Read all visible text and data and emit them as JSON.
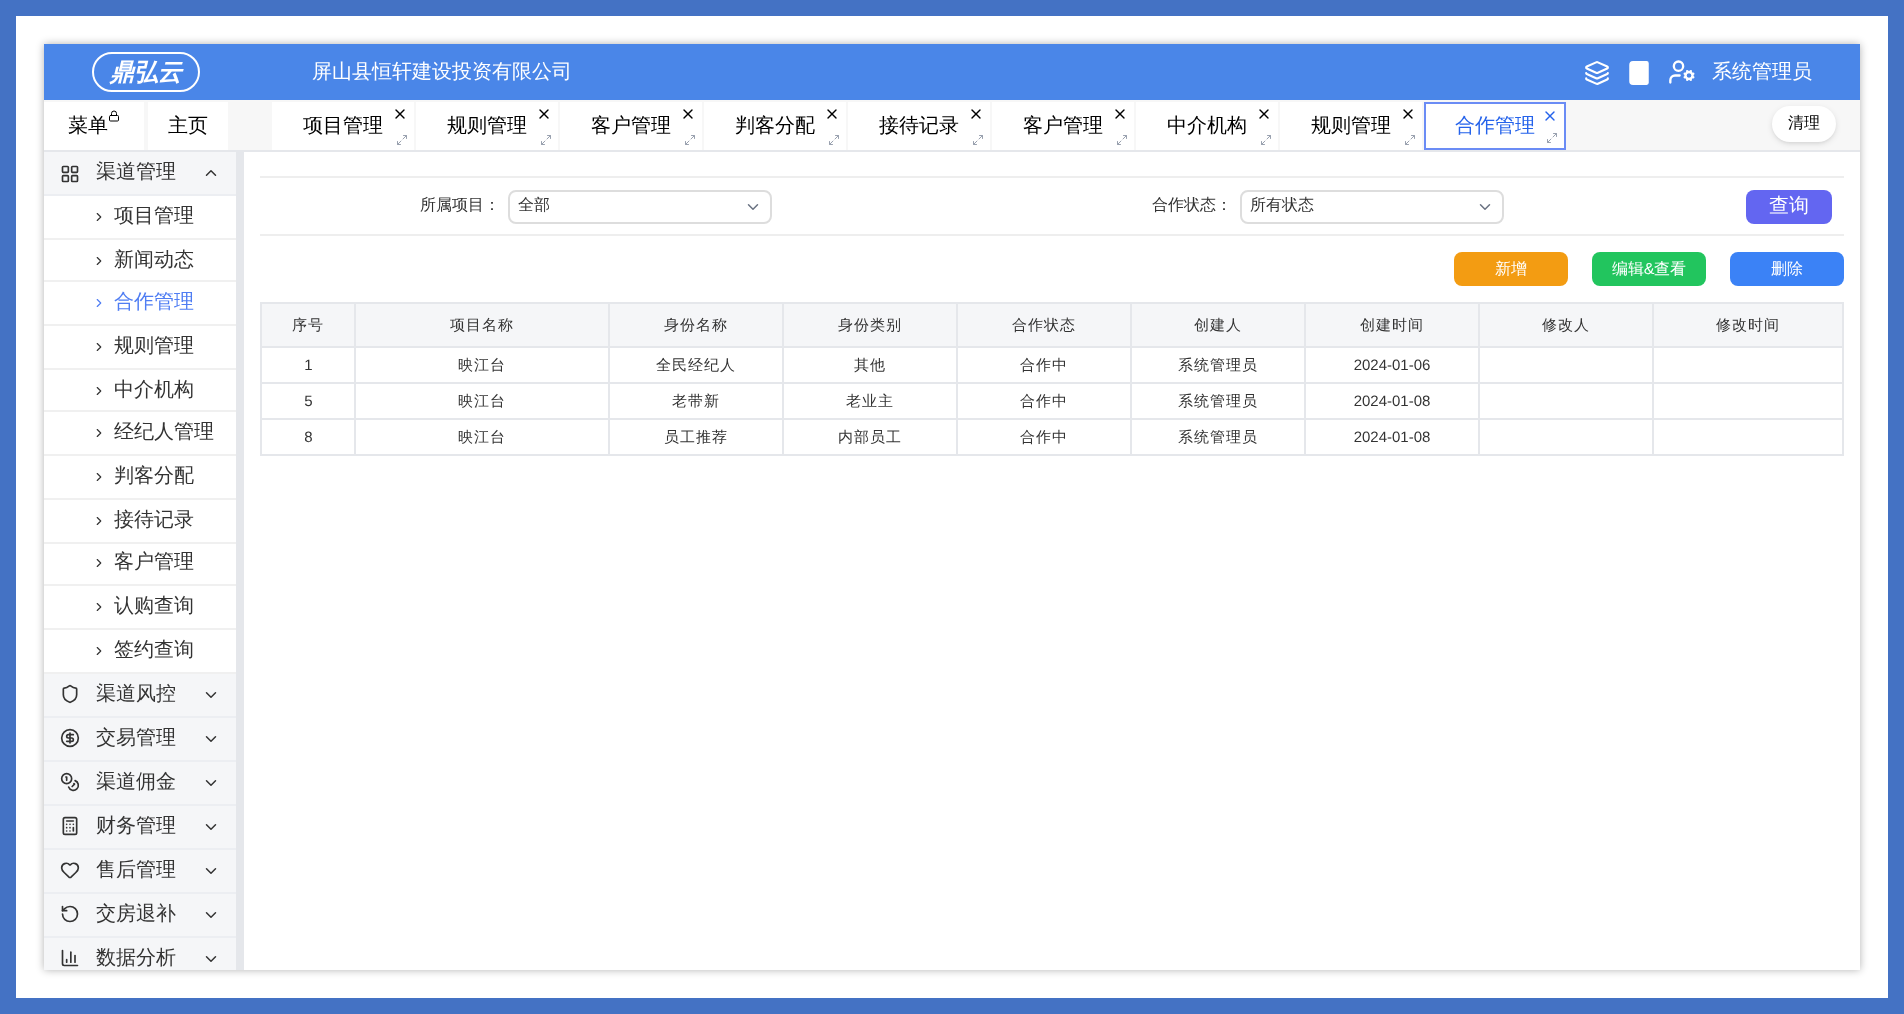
{
  "header": {
    "logo": "鼎弘云",
    "company": "屏山县恒轩建设投资有限公司",
    "user": "系统管理员"
  },
  "nav": {
    "menu": "菜单",
    "home": "主页",
    "clear": "清理"
  },
  "tabs": [
    {
      "label": "项目管理",
      "selected": false
    },
    {
      "label": "规则管理",
      "selected": false
    },
    {
      "label": "客户管理",
      "selected": false
    },
    {
      "label": "判客分配",
      "selected": false
    },
    {
      "label": "接待记录",
      "selected": false
    },
    {
      "label": "客户管理",
      "selected": false
    },
    {
      "label": "中介机构",
      "selected": false
    },
    {
      "label": "规则管理",
      "selected": false
    },
    {
      "label": "合作管理",
      "selected": true
    }
  ],
  "sidebar": [
    {
      "label": "渠道管理",
      "expanded": true,
      "children": [
        {
          "label": "项目管理",
          "selected": false
        },
        {
          "label": "新闻动态",
          "selected": false
        },
        {
          "label": "合作管理",
          "selected": true
        },
        {
          "label": "规则管理",
          "selected": false
        },
        {
          "label": "中介机构",
          "selected": false
        },
        {
          "label": "经纪人管理",
          "selected": false
        },
        {
          "label": "判客分配",
          "selected": false
        },
        {
          "label": "接待记录",
          "selected": false
        },
        {
          "label": "客户管理",
          "selected": false
        },
        {
          "label": "认购查询",
          "selected": false
        },
        {
          "label": "签约查询",
          "selected": false
        }
      ]
    },
    {
      "label": "渠道风控",
      "expanded": false
    },
    {
      "label": "交易管理",
      "expanded": false
    },
    {
      "label": "渠道佣金",
      "expanded": false
    },
    {
      "label": "财务管理",
      "expanded": false
    },
    {
      "label": "售后管理",
      "expanded": false
    },
    {
      "label": "交房退补",
      "expanded": false
    },
    {
      "label": "数据分析",
      "expanded": false
    }
  ],
  "filters": [
    {
      "label": "所属项目：",
      "value": "全部"
    },
    {
      "label": "合作状态：",
      "value": "所有状态"
    }
  ],
  "query_button": "查询",
  "actions": [
    {
      "label": "新增",
      "color": "#f39c12"
    },
    {
      "label": "编辑&查看",
      "color": "#22c55e"
    },
    {
      "label": "删除",
      "color": "#3b82f6"
    }
  ],
  "table": {
    "columns": [
      "序号",
      "项目名称",
      "身份名称",
      "身份类别",
      "合作状态",
      "创建人",
      "创建时间",
      "修改人",
      "修改时间"
    ],
    "rows": [
      [
        "1",
        "映江台",
        "全民经纪人",
        "其他",
        "合作中",
        "系统管理员",
        "2024-01-06",
        "",
        ""
      ],
      [
        "5",
        "映江台",
        "老带新",
        "老业主",
        "合作中",
        "系统管理员",
        "2024-01-08",
        "",
        ""
      ],
      [
        "8",
        "映江台",
        "员工推荐",
        "内部员工",
        "合作中",
        "系统管理员",
        "2024-01-08",
        "",
        ""
      ]
    ]
  }
}
